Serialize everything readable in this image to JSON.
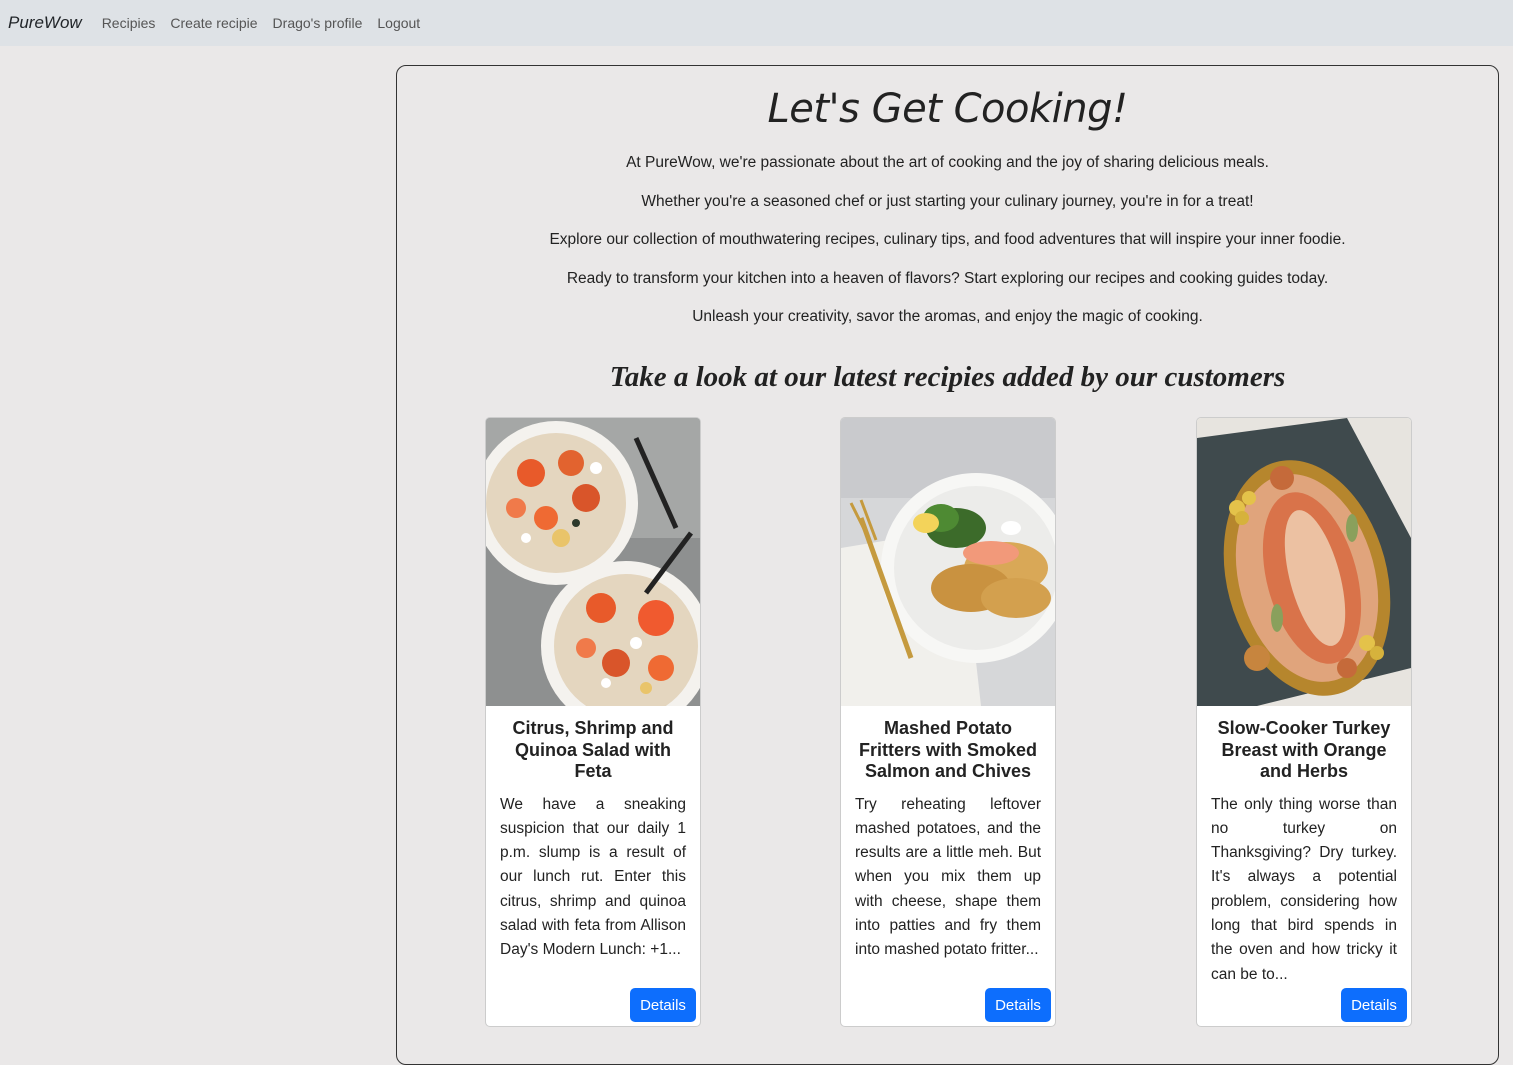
{
  "navbar": {
    "brand": "PureWow",
    "links": [
      "Recipies",
      "Create recipie",
      "Drago's profile",
      "Logout"
    ]
  },
  "main": {
    "heading": "Let's Get Cooking!",
    "intro": [
      "At PureWow, we're passionate about the art of cooking and the joy of sharing delicious meals.",
      "Whether you're a seasoned chef or just starting your culinary journey, you're in for a treat!",
      "Explore our collection of mouthwatering recipes, culinary tips, and food adventures that will inspire your inner foodie.",
      "Ready to transform your kitchen into a heaven of flavors? Start exploring our recipes and cooking guides today.",
      "Unleash your creativity, savor the aromas, and enjoy the magic of cooking."
    ],
    "subheading": "Take a look at our latest recipies added by our customers"
  },
  "recipes": [
    {
      "title": "Citrus, Shrimp and Quinoa Salad with Feta",
      "description": "We have a sneaking suspicion that our daily 1 p.m. slump is a result of our lunch rut. Enter this citrus, shrimp and quinoa salad with feta from Allison Day's Modern Lunch: +1...",
      "button": "Details",
      "image": "shrimp-salad-photo"
    },
    {
      "title": "Mashed Potato Fritters with Smoked Salmon and Chives",
      "description": "Try reheating leftover mashed potatoes, and the results are a little meh. But when you mix them up with cheese, shape them into patties and fry them into mashed potato fritter...",
      "button": "Details",
      "image": "potato-fritters-photo"
    },
    {
      "title": "Slow-Cooker Turkey Breast with Orange and Herbs",
      "description": "The only thing worse than no turkey on Thanksgiving? Dry turkey. It's always a potential problem, considering how long that bird spends in the oven and how tricky it can be to...",
      "button": "Details",
      "image": "turkey-breast-photo"
    }
  ]
}
